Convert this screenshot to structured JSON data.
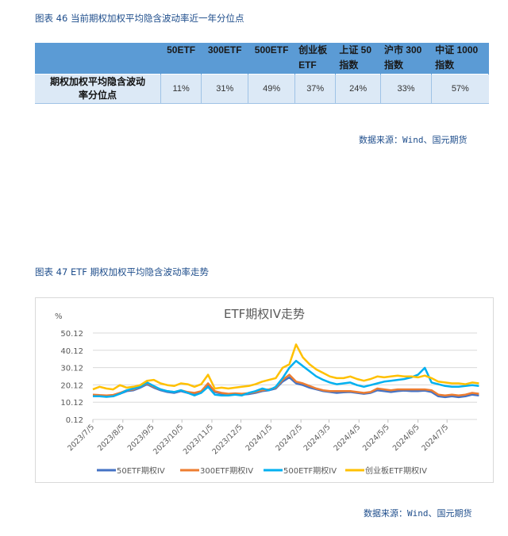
{
  "table_section": {
    "caption": "图表 46  当前期权加权平均隐含波动率近一年分位点",
    "headers": [
      "",
      "50ETF",
      "300ETF",
      "500ETF",
      "创业板ETF",
      "上证 50 指数",
      "沪市 300 指数",
      "中证 1000 指数"
    ],
    "header_lines": [
      [
        ""
      ],
      [
        "50ETF"
      ],
      [
        "300ETF"
      ],
      [
        "500ETF"
      ],
      [
        "创业板",
        "ETF"
      ],
      [
        "上证  50",
        "指数"
      ],
      [
        "沪市  300",
        "指数"
      ],
      [
        "中证  1000",
        "指数"
      ]
    ],
    "row_label_lines": [
      "期权加权平均隐含波动",
      "率分位点"
    ],
    "values": [
      "11%",
      "31%",
      "49%",
      "37%",
      "24%",
      "33%",
      "57%"
    ],
    "source": "数据来源：Wind、国元期货"
  },
  "chart_section": {
    "caption": "图表 47 ETF 期权加权平均隐含波动率走势",
    "source": "数据来源：Wind、国元期货"
  },
  "chart_data": {
    "type": "line",
    "title": "ETF期权IV走势",
    "ylabel": "%",
    "xlabel": "",
    "ylim": [
      0.12,
      50.12
    ],
    "yticks": [
      "0.12",
      "10.12",
      "20.12",
      "30.12",
      "40.12",
      "50.12"
    ],
    "ytick_values": [
      0.12,
      10.12,
      20.12,
      30.12,
      40.12,
      50.12
    ],
    "xticks": [
      "2023/7/5",
      "2023/8/5",
      "2023/9/5",
      "2023/10/5",
      "2023/11/5",
      "2023/12/5",
      "2024/1/5",
      "2024/2/5",
      "2024/3/5",
      "2024/4/5",
      "2024/5/5",
      "2024/6/5",
      "2024/7/5"
    ],
    "x_start": "2023/7/5",
    "x_end": "2024/8/5",
    "x_step_days": 7,
    "grid": true,
    "legend": "bottom",
    "series": [
      {
        "name": "50ETF期权IV",
        "color": "#4472c4",
        "values": [
          14.2,
          14.0,
          13.8,
          14.0,
          15.0,
          16.5,
          17.0,
          18.5,
          20.5,
          18.5,
          17.0,
          16.0,
          15.5,
          16.5,
          15.5,
          15.0,
          16.0,
          20.5,
          16.0,
          15.0,
          14.5,
          14.8,
          14.5,
          14.8,
          15.5,
          16.5,
          17.0,
          18.0,
          22.0,
          24.5,
          21.0,
          20.0,
          18.5,
          17.5,
          16.5,
          16.0,
          15.5,
          15.8,
          16.0,
          15.5,
          15.0,
          15.5,
          17.0,
          16.5,
          16.0,
          16.5,
          16.8,
          16.5,
          16.5,
          16.8,
          16.0,
          13.5,
          13.0,
          13.5,
          13.0,
          13.5,
          14.5,
          14.0
        ]
      },
      {
        "name": "300ETF期权IV",
        "color": "#ed7d31",
        "values": [
          14.5,
          14.2,
          14.0,
          14.3,
          15.5,
          17.0,
          17.5,
          19.0,
          21.0,
          19.0,
          17.5,
          16.5,
          16.0,
          17.0,
          16.0,
          15.5,
          16.5,
          21.0,
          16.5,
          15.5,
          15.0,
          15.2,
          15.0,
          15.3,
          16.0,
          17.0,
          17.5,
          18.5,
          23.0,
          26.0,
          22.0,
          21.0,
          19.5,
          18.0,
          17.0,
          16.5,
          16.5,
          16.5,
          16.5,
          16.0,
          15.5,
          16.0,
          18.0,
          17.5,
          17.0,
          17.5,
          17.5,
          17.5,
          17.5,
          17.5,
          17.0,
          14.5,
          14.0,
          14.5,
          14.0,
          14.5,
          15.5,
          15.0
        ]
      },
      {
        "name": "500ETF期权IV",
        "color": "#00b0f0",
        "values": [
          13.5,
          13.5,
          13.2,
          13.5,
          15.0,
          17.0,
          18.0,
          19.0,
          21.5,
          19.5,
          17.5,
          16.5,
          16.0,
          17.0,
          15.5,
          14.0,
          15.5,
          19.0,
          14.5,
          14.0,
          14.0,
          14.5,
          14.0,
          15.5,
          16.5,
          18.0,
          17.0,
          19.0,
          24.0,
          30.0,
          34.0,
          31.0,
          28.0,
          25.0,
          23.0,
          21.5,
          20.5,
          21.0,
          21.5,
          20.0,
          19.0,
          20.0,
          21.0,
          22.0,
          22.5,
          23.0,
          23.5,
          24.5,
          26.0,
          30.0,
          21.5,
          20.5,
          19.5,
          19.0,
          19.0,
          19.5,
          20.0,
          19.5
        ]
      },
      {
        "name": "创业板ETF期权IV",
        "color": "#ffc000",
        "values": [
          17.5,
          19.0,
          18.0,
          17.5,
          20.0,
          18.5,
          19.0,
          20.0,
          22.5,
          23.0,
          21.0,
          20.0,
          19.5,
          21.0,
          20.5,
          19.0,
          20.5,
          26.0,
          18.0,
          18.5,
          18.0,
          18.5,
          19.0,
          19.5,
          20.5,
          22.0,
          23.0,
          24.0,
          30.0,
          32.0,
          43.5,
          36.0,
          32.0,
          29.0,
          27.0,
          25.0,
          24.0,
          24.0,
          25.0,
          23.5,
          22.5,
          23.5,
          25.0,
          24.5,
          25.0,
          25.5,
          25.0,
          25.0,
          24.5,
          25.5,
          24.0,
          22.0,
          21.5,
          21.0,
          21.0,
          20.5,
          21.5,
          21.0
        ]
      }
    ]
  }
}
